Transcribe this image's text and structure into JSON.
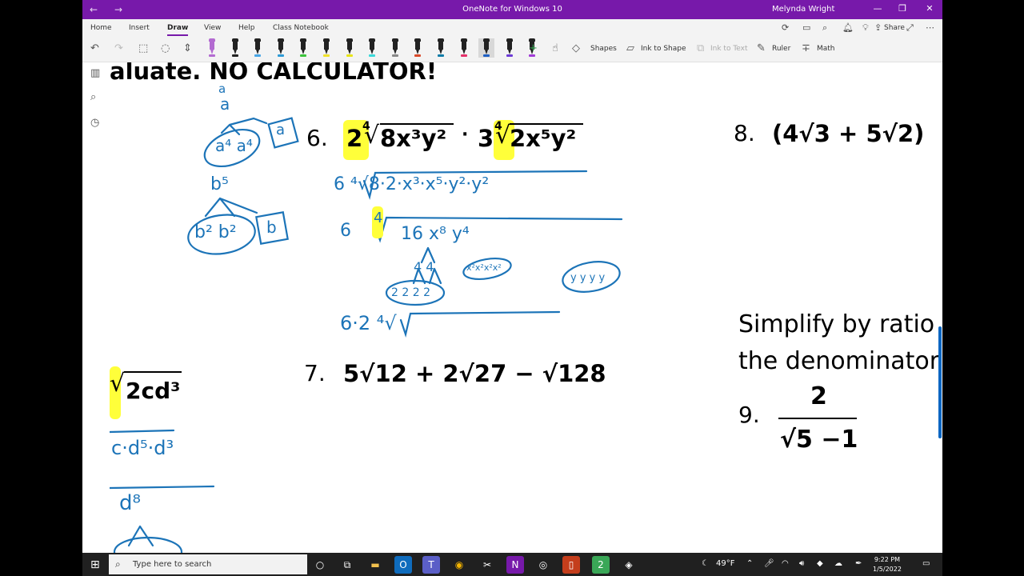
{
  "window": {
    "title": "OneNote for Windows 10",
    "user": "Melynda Wright",
    "back_icon": "←",
    "forward_icon": "→",
    "minimize": "—",
    "maximize": "❐",
    "close": "✕"
  },
  "ribbon": {
    "tabs": [
      "Home",
      "Insert",
      "Draw",
      "View",
      "Help",
      "Class Notebook"
    ],
    "active_tab": "Draw",
    "share_label": "Share"
  },
  "toolbar": {
    "shapes_label": "Shapes",
    "ink_to_shape_label": "Ink to Shape",
    "ink_to_text_label": "Ink to Text",
    "ruler_label": "Ruler",
    "math_label": "Math",
    "pens": [
      {
        "color": "#b36bd1",
        "band": "#b36bd1"
      },
      {
        "color": "#222222",
        "band": "#222222"
      },
      {
        "color": "#222222",
        "band": "#49a6e6"
      },
      {
        "color": "#222222",
        "band": "#2e9bd6"
      },
      {
        "color": "#222222",
        "band": "#3cc43c"
      },
      {
        "color": "#222222",
        "band": "#f0e22a"
      },
      {
        "color": "#222222",
        "band": "#e8e419"
      },
      {
        "color": "#222222",
        "band": "#3ad9d9"
      },
      {
        "color": "#222222",
        "band": "#888888"
      },
      {
        "color": "#222222",
        "band": "#d94a2a"
      },
      {
        "color": "#222222",
        "band": "#0f7ca8"
      },
      {
        "color": "#222222",
        "band": "#e5306a"
      },
      {
        "color": "#222222",
        "band": "#1e5fc4"
      },
      {
        "color": "#222222",
        "band": "#6d3bd6"
      },
      {
        "color": "#222222",
        "band": "#a13bd6"
      }
    ]
  },
  "canvas": {
    "header_text": "aluate.   NO CALCULATOR!",
    "problem6": {
      "number": "6.",
      "coeff1": "2",
      "index1": "4",
      "rad1": "8x³y²",
      "dot": "·",
      "coeff2": "3",
      "index2": "4",
      "rad2": "2x⁵y²"
    },
    "problem7": {
      "number": "7.",
      "expr": "5√12 + 2√27 − √128"
    },
    "problem8": {
      "number": "8.",
      "expr": "(4√3 + 5√2)"
    },
    "problem_left": {
      "rad": "2cd³"
    },
    "simplify_line1": "Simplify by ratio",
    "simplify_line2": "the denominator",
    "problem9": {
      "number": "9.",
      "numerator": "2",
      "denominator": "√5 −1"
    },
    "ink": {
      "a_top": "a",
      "a_mid": "a",
      "a4a4": "a⁴ a⁴",
      "a_box": "a",
      "b5": "b⁵",
      "b2b2": "b² b²",
      "b_box": "b",
      "line1": "6 ⁴√8·2·x³·x⁵·y²·y²",
      "line2_coeff": "6",
      "line2_index": "4",
      "line2_rad": "16  x⁸  y⁴",
      "fac16": "4  4",
      "fac16b": "2 2  2 2",
      "facx": "x²x²x²x²",
      "facy": "y y y y",
      "line3": "6·2 ⁴√",
      "left_line1": "c·d⁵·d³",
      "left_line2": "d⁸"
    }
  },
  "taskbar": {
    "search_placeholder": "Type here to search",
    "weather": "49°F",
    "time": "9:22 PM",
    "date": "1/5/2022"
  }
}
